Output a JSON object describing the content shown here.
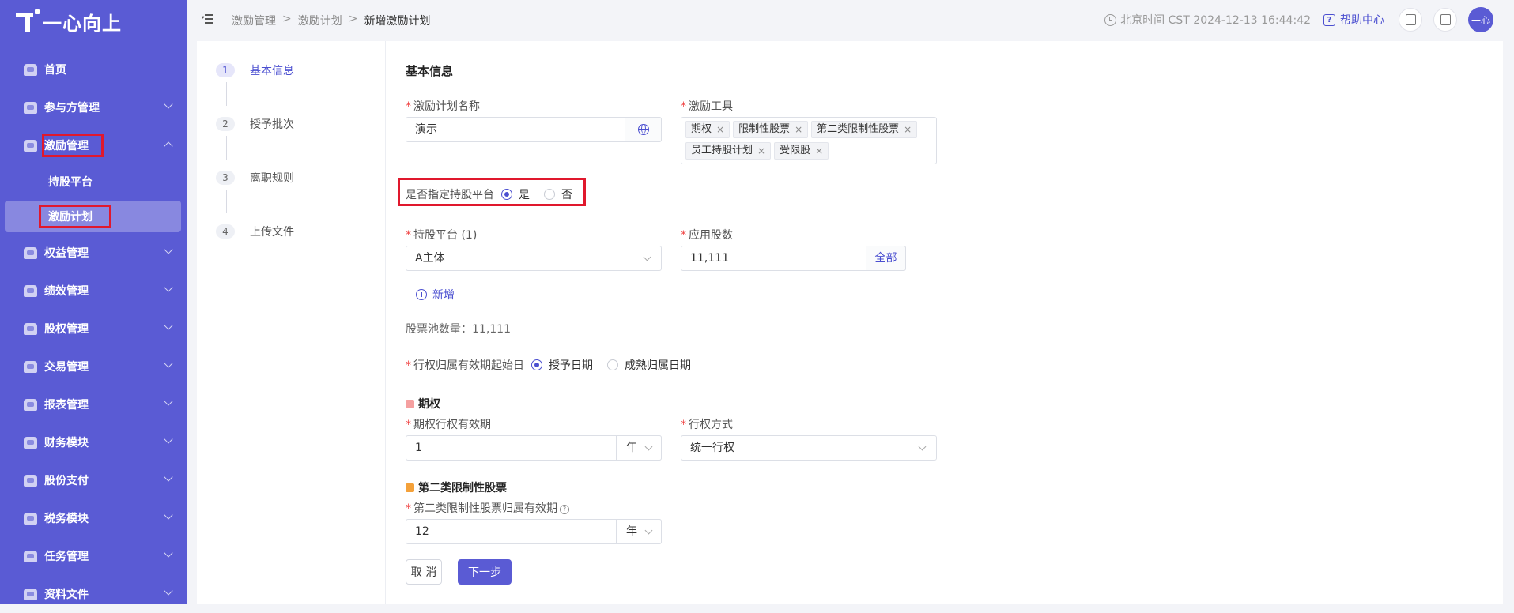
{
  "brand": {
    "name": "一心向上"
  },
  "sidebar": {
    "items": [
      {
        "label": "首页",
        "icon": "home-icon"
      },
      {
        "label": "参与方管理",
        "icon": "users-icon"
      },
      {
        "label": "激励管理",
        "icon": "incentive-icon"
      },
      {
        "label": "持股平台",
        "sub": true
      },
      {
        "label": "激励计划",
        "sub": true,
        "active": true
      },
      {
        "label": "权益管理",
        "icon": "equity-icon"
      },
      {
        "label": "绩效管理",
        "icon": "performance-icon"
      },
      {
        "label": "股权管理",
        "icon": "shares-icon"
      },
      {
        "label": "交易管理",
        "icon": "trade-icon"
      },
      {
        "label": "报表管理",
        "icon": "report-icon"
      },
      {
        "label": "财务模块",
        "icon": "finance-icon"
      },
      {
        "label": "股份支付",
        "icon": "payment-icon"
      },
      {
        "label": "税务模块",
        "icon": "tax-icon"
      },
      {
        "label": "任务管理",
        "icon": "task-icon"
      },
      {
        "label": "资料文件",
        "icon": "file-icon"
      }
    ]
  },
  "header": {
    "breadcrumb": [
      "激励管理",
      "激励计划",
      "新增激励计划"
    ],
    "time": "北京时间 CST 2024-12-13 16:44:42",
    "help": "帮助中心",
    "avatar": "一心"
  },
  "steps": [
    {
      "num": "1",
      "label": "基本信息"
    },
    {
      "num": "2",
      "label": "授予批次"
    },
    {
      "num": "3",
      "label": "离职规则"
    },
    {
      "num": "4",
      "label": "上传文件"
    }
  ],
  "form": {
    "section_title": "基本信息",
    "plan_name": {
      "label": "激励计划名称",
      "value": "演示"
    },
    "tools": {
      "label": "激励工具",
      "tags": [
        "期权",
        "限制性股票",
        "第二类限制性股票",
        "员工持股计划",
        "受限股"
      ]
    },
    "platform_switch": {
      "label": "是否指定持股平台",
      "yes": "是",
      "no": "否",
      "selected": "是"
    },
    "platform": {
      "label": "持股平台 (1)",
      "value": "A主体"
    },
    "shares": {
      "label": "应用股数",
      "value": "11,111",
      "all": "全部"
    },
    "add": "新增",
    "pool": "股票池数量：11,111",
    "vest_start": {
      "label": "行权归属有效期起始日",
      "opt1": "授予日期",
      "opt2": "成熟归属日期",
      "selected": "授予日期"
    },
    "option_section": {
      "title": "期权",
      "color": "#f28b8b"
    },
    "option_period": {
      "label": "期权行权有效期",
      "value": "1",
      "unit": "年"
    },
    "exercise_method": {
      "label": "行权方式",
      "value": "统一行权"
    },
    "rs2_section": {
      "title": "第二类限制性股票",
      "color": "#f4a13a"
    },
    "rs2_period": {
      "label": "第二类限制性股票归属有效期",
      "value": "12",
      "unit": "年"
    },
    "cancel": "取 消",
    "next": "下一步"
  }
}
